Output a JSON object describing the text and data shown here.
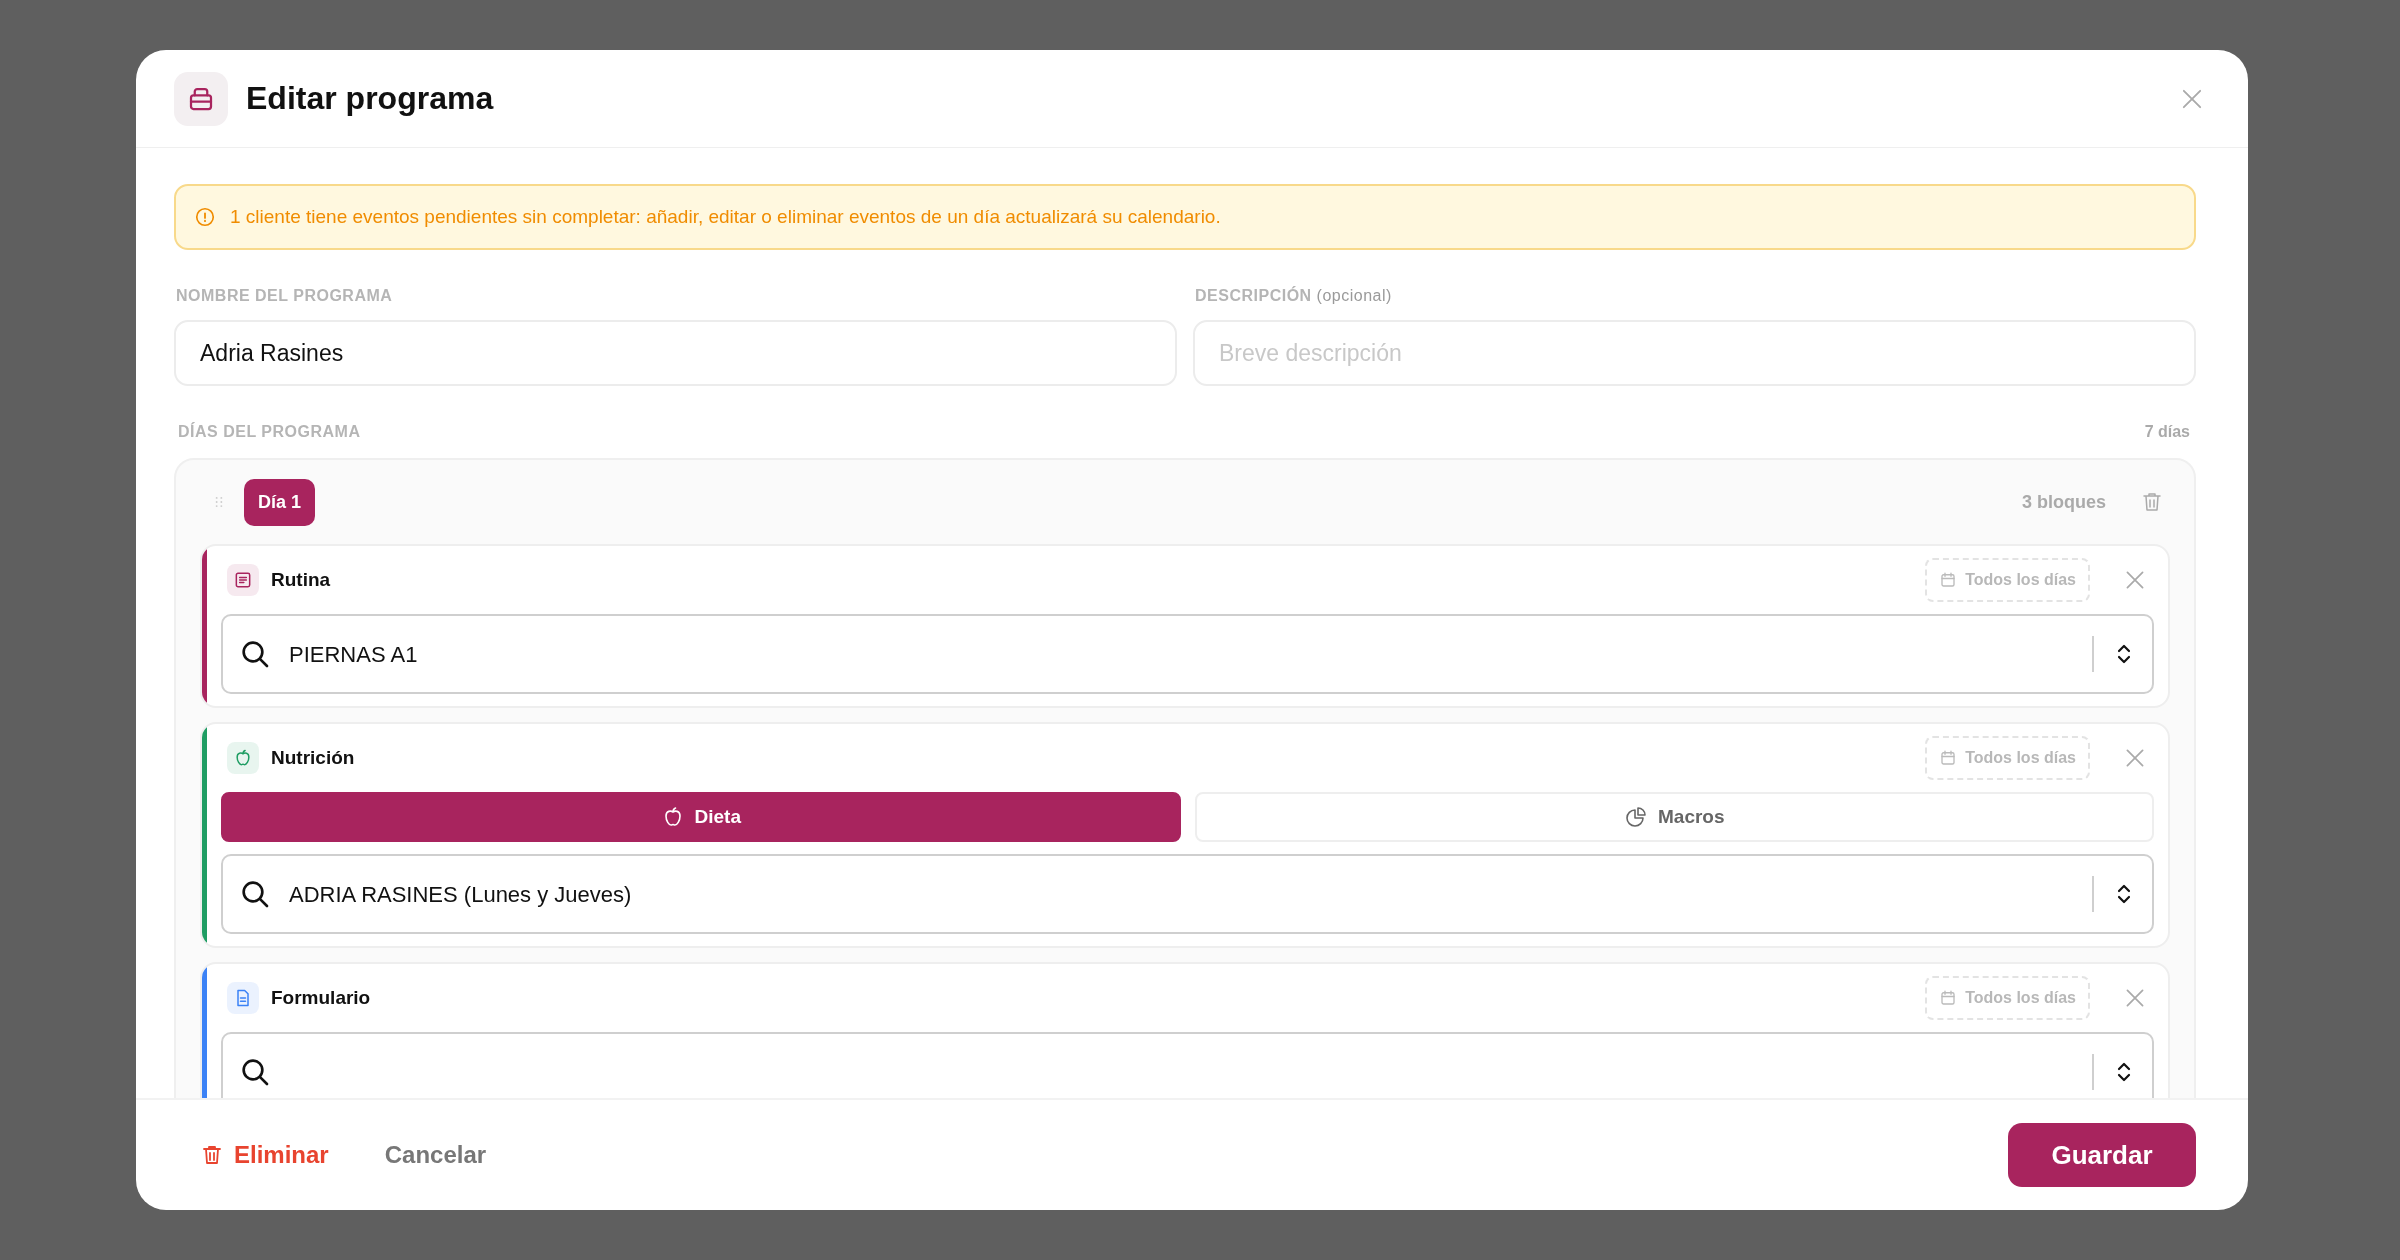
{
  "modal": {
    "title": "Editar programa"
  },
  "alert": {
    "text": "1 cliente tiene eventos pendientes sin completar: añadir, editar o eliminar eventos de un día actualizará su calendario."
  },
  "fields": [
    {
      "label": "NOMBRE DEL PROGRAMA",
      "value": "Adria Rasines"
    },
    {
      "label": "DESCRIPCIÓN",
      "label_note": "(opcional)",
      "placeholder": "Breve descripción"
    }
  ],
  "days_section": {
    "label": "DÍAS DEL PROGRAMA",
    "count": "7 días"
  },
  "days": [
    {
      "label": "Día 1",
      "count": "3 bloques",
      "blocks": [
        {
          "kind": "rutina",
          "title": "Rutina",
          "color": "#a8245e",
          "schedule": "Todos los días",
          "value": "PIERNAS A1"
        },
        {
          "kind": "nutricion",
          "title": "Nutrición",
          "color": "#1f9d63",
          "schedule": "Todos los días",
          "options": [
            {
              "label": "Dieta",
              "kind": "diet",
              "selected": true
            },
            {
              "label": "Macros",
              "kind": "macros",
              "selected": false
            }
          ],
          "value": "ADRIA RASINES (Lunes y Jueves)"
        },
        {
          "kind": "formulario",
          "title": "Formulario",
          "color": "#3b82f6",
          "schedule": "Todos los días"
        }
      ]
    }
  ],
  "footer": {
    "delete": "Eliminar",
    "cancel": "Cancelar",
    "save": "Guardar"
  }
}
